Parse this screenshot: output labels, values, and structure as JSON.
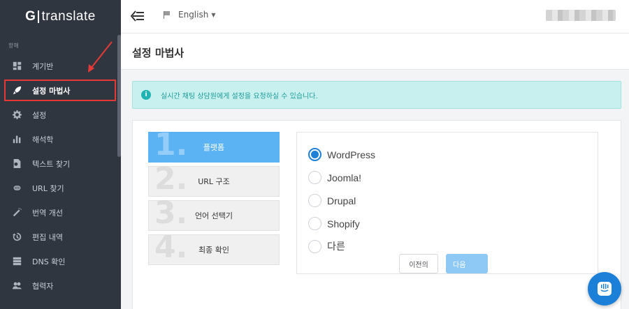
{
  "brand": {
    "left": "G",
    "right": "translate"
  },
  "sidebar": {
    "section": "항해",
    "items": [
      {
        "label": "계기반",
        "icon": "dashboard-icon"
      },
      {
        "label": "설정 마법사",
        "icon": "rocket-icon",
        "active": true
      },
      {
        "label": "설정",
        "icon": "gear-icon"
      },
      {
        "label": "해석학",
        "icon": "bar-chart-icon"
      },
      {
        "label": "텍스트 찾기",
        "icon": "document-search-icon"
      },
      {
        "label": "URL 찾기",
        "icon": "link-icon"
      },
      {
        "label": "번역 개선",
        "icon": "magic-wand-icon"
      },
      {
        "label": "편집 내역",
        "icon": "history-icon"
      },
      {
        "label": "DNS 확인",
        "icon": "server-icon"
      },
      {
        "label": "협력자",
        "icon": "users-icon"
      }
    ]
  },
  "topbar": {
    "language": "English"
  },
  "page": {
    "title": "설정 마법사",
    "info": "실시간 채팅 상담원에게 설정을 요청하실 수 있습니다."
  },
  "steps": [
    {
      "num": "1.",
      "label": "플랫폼",
      "active": true
    },
    {
      "num": "2.",
      "label": "URL 구조"
    },
    {
      "num": "3.",
      "label": "언어 선택기"
    },
    {
      "num": "4.",
      "label": "최종 확인"
    }
  ],
  "options": [
    {
      "label": "WordPress",
      "checked": true
    },
    {
      "label": "Joomla!"
    },
    {
      "label": "Drupal"
    },
    {
      "label": "Shopify"
    },
    {
      "label": "다른"
    }
  ],
  "buttons": {
    "prev": "이전의",
    "next": "다음"
  },
  "colors": {
    "sidebar": "#2f3640",
    "accent": "#1d7fd6",
    "step_active": "#5bb3f4",
    "info_bg": "#c8f0ef",
    "highlight": "#e53935"
  }
}
